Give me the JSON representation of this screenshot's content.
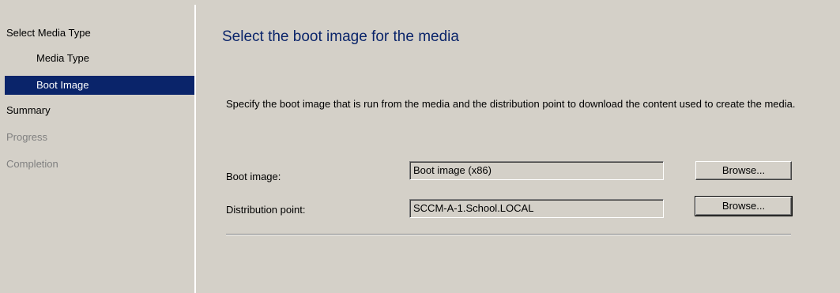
{
  "sidebar": {
    "items": [
      {
        "label": "Select Media Type"
      },
      {
        "label": "Media Type"
      },
      {
        "label": "Boot Image"
      },
      {
        "label": "Summary"
      },
      {
        "label": "Progress"
      },
      {
        "label": "Completion"
      }
    ],
    "selected_color": "#0a246a"
  },
  "main": {
    "title": "Select the boot image for the media",
    "description": "Specify the boot image that is run from the media and the distribution point to download the content used to create the media.",
    "boot_image": {
      "label": "Boot image:",
      "value": "Boot image (x86)",
      "browse_label": "Browse..."
    },
    "distribution_point": {
      "label": "Distribution point:",
      "value": "SCCM-A-1.School.LOCAL",
      "browse_label": "Browse..."
    }
  }
}
